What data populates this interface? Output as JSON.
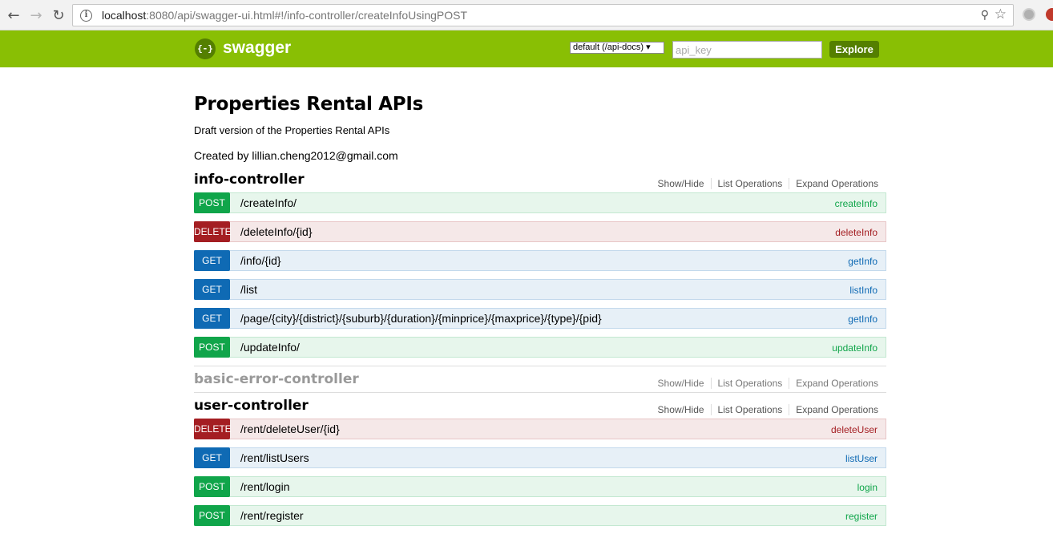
{
  "browser": {
    "url_host": "localhost",
    "url_rest": ":8080/api/swagger-ui.html#!/info-controller/createInfoUsingPOST"
  },
  "header": {
    "logo_icon_text": "{-}",
    "logo_text": "swagger",
    "spec_select": "default (/api-docs) ▾",
    "api_key_placeholder": "api_key",
    "explore_label": "Explore",
    "colors": {
      "bar": "#89bf04",
      "dark": "#547f00"
    }
  },
  "info": {
    "title": "Properties Rental APIs",
    "description": "Draft version of the Properties Rental APIs",
    "created_by": "Created by lillian.cheng2012@gmail.com"
  },
  "resource_links": {
    "show_hide": "Show/Hide",
    "list_ops": "List Operations",
    "expand_ops": "Expand Operations"
  },
  "resources": [
    {
      "name": "info-controller",
      "operations": [
        {
          "method": "POST",
          "path": "/createInfo/",
          "nickname": "createInfo"
        },
        {
          "method": "DELETE",
          "path": "/deleteInfo/{id}",
          "nickname": "deleteInfo"
        },
        {
          "method": "GET",
          "path": "/info/{id}",
          "nickname": "getInfo"
        },
        {
          "method": "GET",
          "path": "/list",
          "nickname": "listInfo"
        },
        {
          "method": "GET",
          "path": "/page/{city}/{district}/{suburb}/{duration}/{minprice}/{maxprice}/{type}/{pid}",
          "nickname": "getInfo"
        },
        {
          "method": "POST",
          "path": "/updateInfo/",
          "nickname": "updateInfo"
        }
      ]
    },
    {
      "name": "basic-error-controller",
      "operations": []
    },
    {
      "name": "user-controller",
      "operations": [
        {
          "method": "DELETE",
          "path": "/rent/deleteUser/{id}",
          "nickname": "deleteUser"
        },
        {
          "method": "GET",
          "path": "/rent/listUsers",
          "nickname": "listUser"
        },
        {
          "method": "POST",
          "path": "/rent/login",
          "nickname": "login"
        },
        {
          "method": "POST",
          "path": "/rent/register",
          "nickname": "register"
        }
      ]
    }
  ]
}
